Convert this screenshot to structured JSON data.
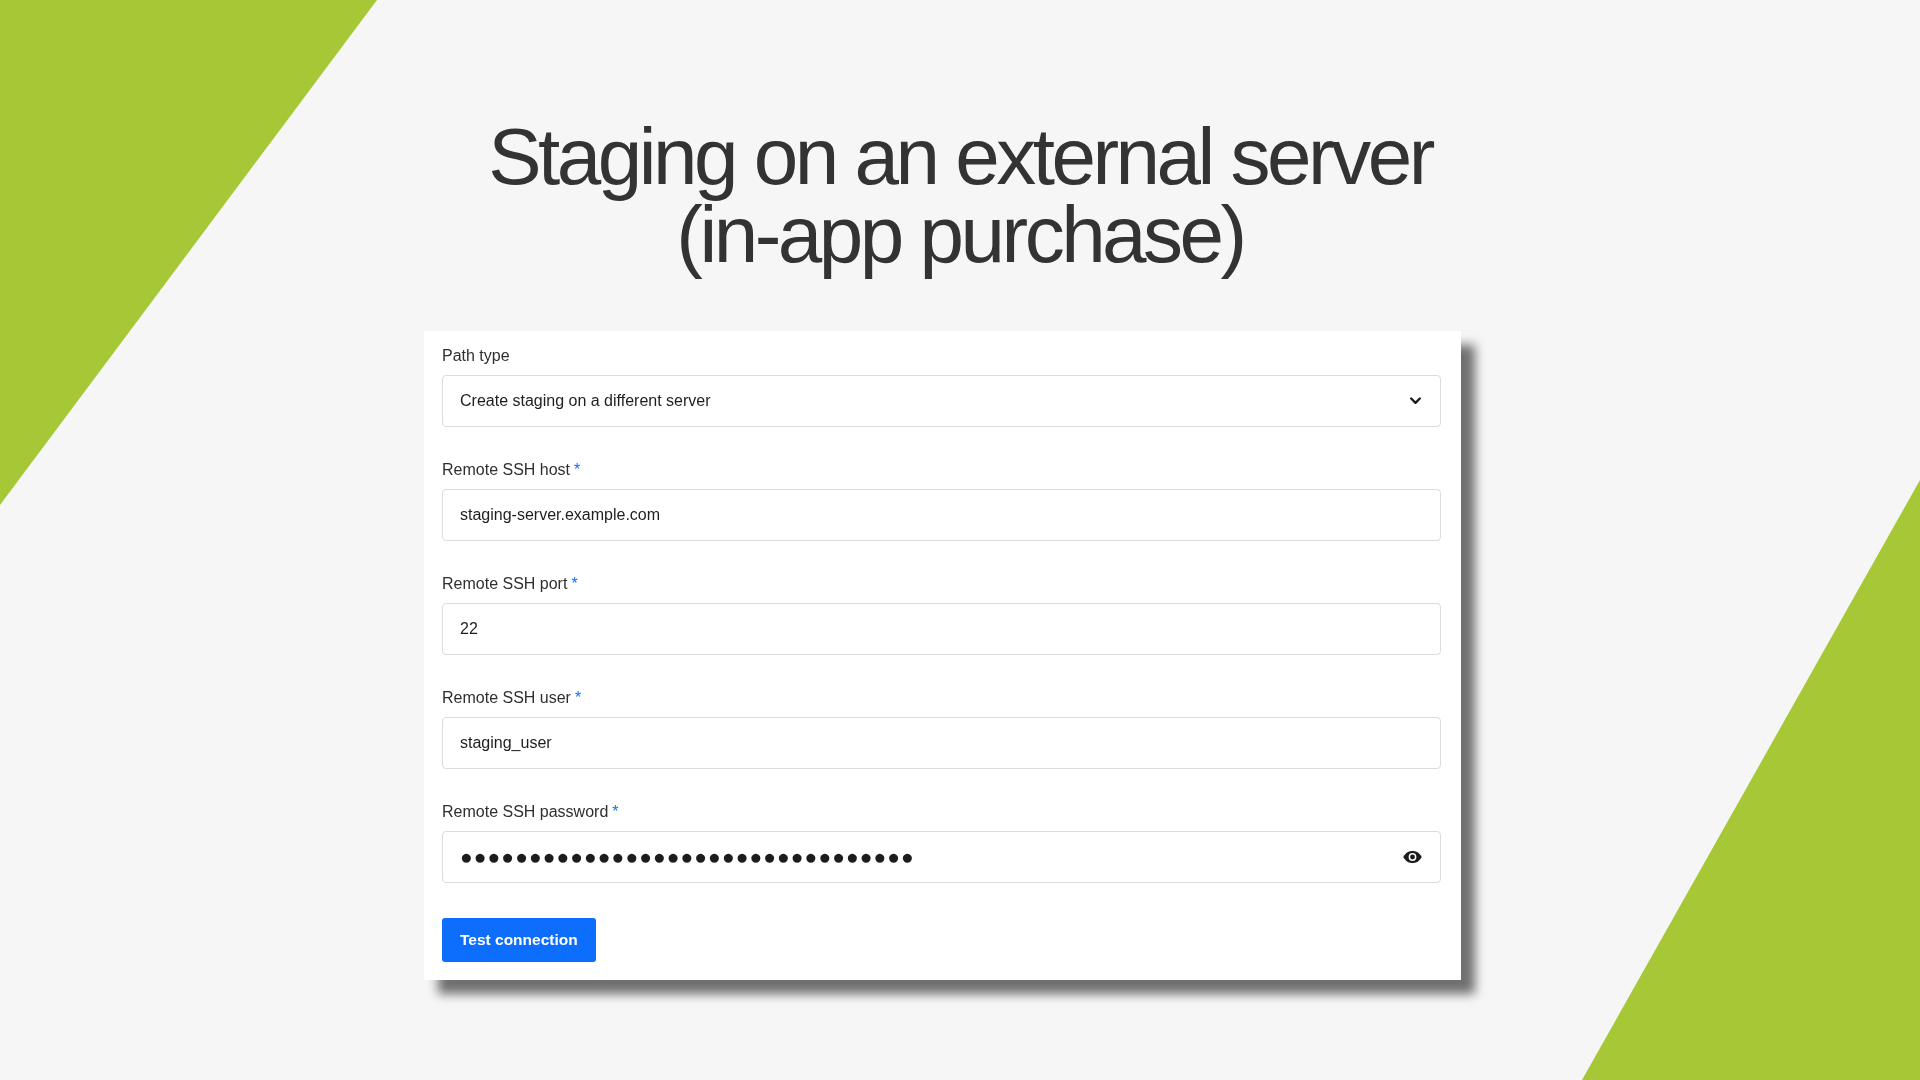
{
  "title": "Staging on an external server (in-app purchase)",
  "form": {
    "fields": [
      {
        "kind": "select",
        "label": "Path type",
        "value": "Create staging on a different server"
      },
      {
        "kind": "text",
        "label": "Remote SSH host",
        "required_mark": "*",
        "value": "staging-server.example.com"
      },
      {
        "kind": "text",
        "label": "Remote SSH port",
        "required_mark": "*",
        "value": "22"
      },
      {
        "kind": "text",
        "label": "Remote SSH user",
        "required_mark": "*",
        "value": "staging_user"
      },
      {
        "kind": "password",
        "label": "Remote SSH password",
        "required_mark": "*",
        "value": "●●●●●●●●●●●●●●●●●●●●●●●●●●●●●●●●●"
      }
    ],
    "button": {
      "label": "Test connection"
    }
  }
}
